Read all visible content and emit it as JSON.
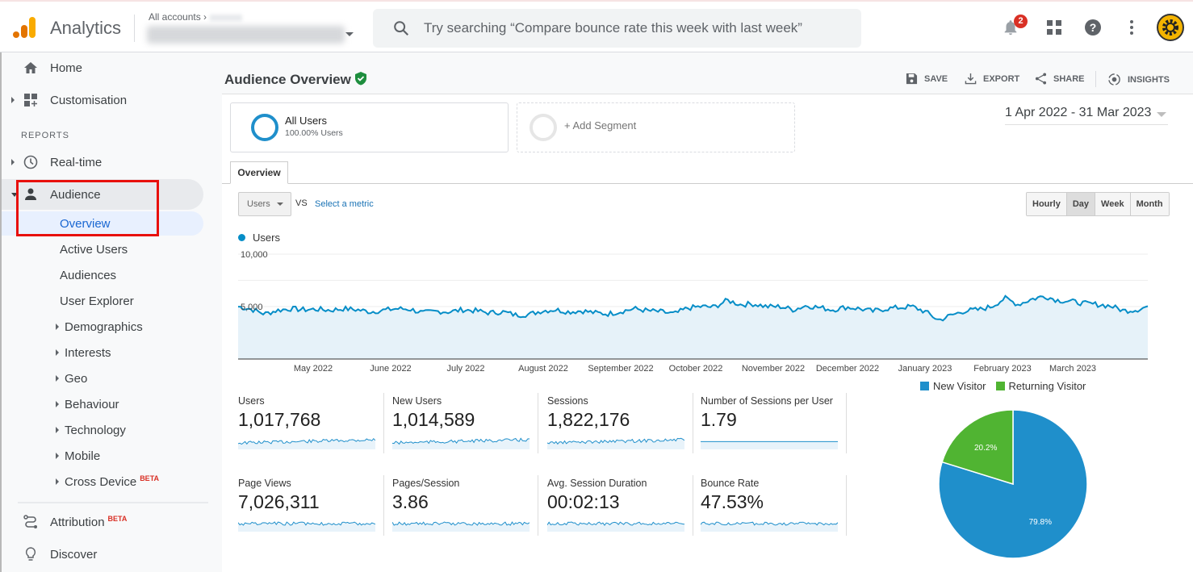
{
  "topbar": {
    "app_name": "Analytics",
    "breadcrumb": "All accounts",
    "breadcrumb_sep": "›",
    "account_name": "[redacted account] All Web Site Data",
    "search_placeholder": "Try searching “Compare bounce rate this week with last week”",
    "notifications_count": "2",
    "icons": [
      "analytics-logo-icon",
      "search-icon",
      "bell-icon",
      "apps-grid-icon",
      "help-icon",
      "more-vert-icon",
      "avatar-gear-icon"
    ]
  },
  "sidebar": {
    "top_items": [
      {
        "label": "Home",
        "icon": "home-icon"
      },
      {
        "label": "Customisation",
        "icon": "dashboard-icon"
      }
    ],
    "section_label": "REPORTS",
    "items": [
      {
        "label": "Real-time",
        "icon": "clock-icon"
      },
      {
        "label": "Audience",
        "icon": "person-icon",
        "expanded": true
      }
    ],
    "audience_sub": [
      {
        "label": "Overview",
        "selected": true
      },
      {
        "label": "Active Users"
      },
      {
        "label": "Audiences"
      },
      {
        "label": "User Explorer"
      },
      {
        "label": "Demographics",
        "expandable": true
      },
      {
        "label": "Interests",
        "expandable": true
      },
      {
        "label": "Geo",
        "expandable": true
      },
      {
        "label": "Behaviour",
        "expandable": true
      },
      {
        "label": "Technology",
        "expandable": true
      },
      {
        "label": "Mobile",
        "expandable": true
      },
      {
        "label": "Cross Device",
        "expandable": true,
        "badge": "BETA"
      }
    ],
    "bottom_items": [
      {
        "label": "Attribution",
        "icon": "attribution-icon",
        "badge": "BETA"
      },
      {
        "label": "Discover",
        "icon": "lightbulb-icon"
      }
    ],
    "highlight_color": "#e8100c"
  },
  "page": {
    "title": "Audience Overview",
    "verified_icon": "shield-check-icon",
    "actions": {
      "save": "SAVE",
      "export": "EXPORT",
      "share": "SHARE",
      "insights": "INSIGHTS"
    },
    "segments": {
      "all_users_title": "All Users",
      "all_users_sub": "100.00% Users",
      "add_segment": "+ Add Segment"
    },
    "date_range": "1 Apr 2022 - 31 Mar 2023",
    "tab": "Overview",
    "metric_select": "Users",
    "vs_label": "VS",
    "select_metric_link": "Select a metric",
    "granularity": [
      "Hourly",
      "Day",
      "Week",
      "Month"
    ],
    "granularity_selected": "Day"
  },
  "chart_data": [
    {
      "type": "area",
      "title": "Users",
      "legend": [
        "Users"
      ],
      "series_color": "#058dc7",
      "ylabel": "",
      "ylim": [
        0,
        10000
      ],
      "yticks": [
        "10,000",
        "5,000"
      ],
      "x_labels": [
        "May 2022",
        "June 2022",
        "July 2022",
        "August 2022",
        "September 2022",
        "October 2022",
        "November 2022",
        "December 2022",
        "January 2023",
        "February 2023",
        "March 2023"
      ],
      "x_range": [
        "2022-04-01",
        "2023-03-31"
      ],
      "weekly_approx_values": [
        5000,
        4750,
        4300,
        4650,
        4800,
        4700,
        4750,
        4650,
        4800,
        4700,
        4500,
        4650,
        4800,
        4750,
        4400,
        4550,
        4500,
        4700,
        4600,
        4400,
        4500,
        4200,
        4250,
        4600,
        4700,
        4500,
        4600,
        4400,
        4300,
        4550,
        4800,
        4600,
        4500,
        4300,
        4850,
        5000,
        4950,
        5600,
        5200,
        5250,
        5000,
        5000,
        4700,
        5100,
        4900,
        4700,
        4950,
        4800,
        4550,
        4800,
        4900,
        5000,
        4500,
        3700,
        4200,
        4600,
        4700,
        5000,
        5800,
        5200,
        5700,
        6000,
        5600,
        5500,
        5300,
        5200,
        5050,
        4600,
        4700,
        5100
      ]
    },
    {
      "type": "pie",
      "legend": [
        "New Visitor",
        "Returning Visitor"
      ],
      "categories": [
        "New Visitor",
        "Returning Visitor"
      ],
      "values": [
        79.8,
        20.2
      ],
      "labels": [
        "79.8%",
        "20.2%"
      ],
      "colors": [
        "#1f8fcb",
        "#50b432"
      ]
    }
  ],
  "metrics": [
    {
      "label": "Users",
      "value": "1,017,768",
      "trend": "up"
    },
    {
      "label": "New Users",
      "value": "1,014,589",
      "trend": "up"
    },
    {
      "label": "Sessions",
      "value": "1,822,176",
      "trend": "up"
    },
    {
      "label": "Number of Sessions per User",
      "value": "1.79",
      "trend": "flat"
    },
    {
      "label": "Page Views",
      "value": "7,026,311",
      "trend": "noisy"
    },
    {
      "label": "Pages/Session",
      "value": "3.86",
      "trend": "flat"
    },
    {
      "label": "Avg. Session Duration",
      "value": "00:02:13",
      "trend": "flat"
    },
    {
      "label": "Bounce Rate",
      "value": "47.53%",
      "trend": "flat"
    }
  ]
}
